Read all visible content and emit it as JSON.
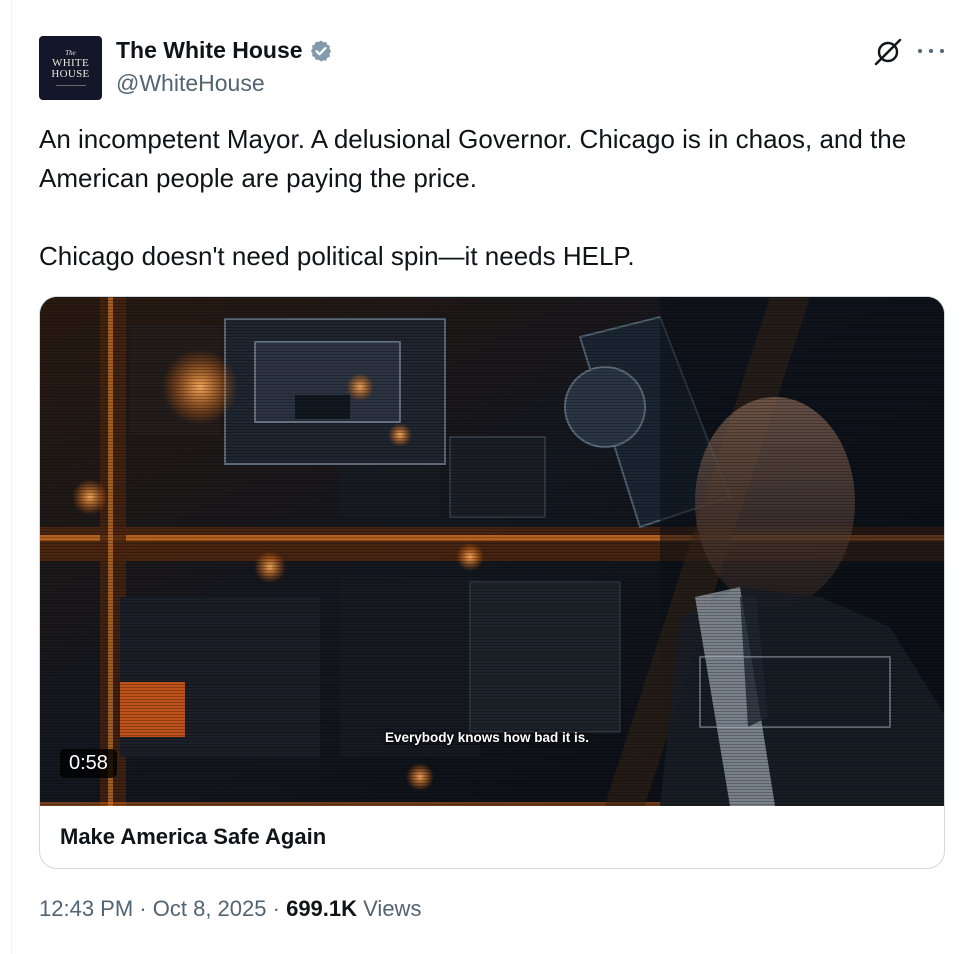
{
  "author": {
    "display_name": "The White House",
    "handle": "@WhiteHouse",
    "verified": true,
    "avatar_lines": [
      "The",
      "WHITE",
      "HOUSE"
    ],
    "avatar_bg": "#14172a"
  },
  "toolbar": {
    "grok_icon": "grok-icon",
    "more_icon": "more-dots-icon"
  },
  "tweet": {
    "text_line1": "An incompetent Mayor. A delusional Governor. Chicago is in chaos, and the American people are paying the price.",
    "text_line2": "Chicago doesn't need political spin—it needs HELP."
  },
  "media": {
    "duration": "0:58",
    "subtitle": "Everybody knows how bad it is.",
    "card_title": "Make America Safe Again"
  },
  "meta": {
    "time": "12:43 PM",
    "separator": "·",
    "date": "Oct 8, 2025",
    "views_count": "699.1K",
    "views_label": "Views"
  },
  "colors": {
    "verified_badge": "#829aab",
    "text_primary": "#0f1419",
    "text_secondary": "#536471",
    "border": "#cfd9de"
  }
}
